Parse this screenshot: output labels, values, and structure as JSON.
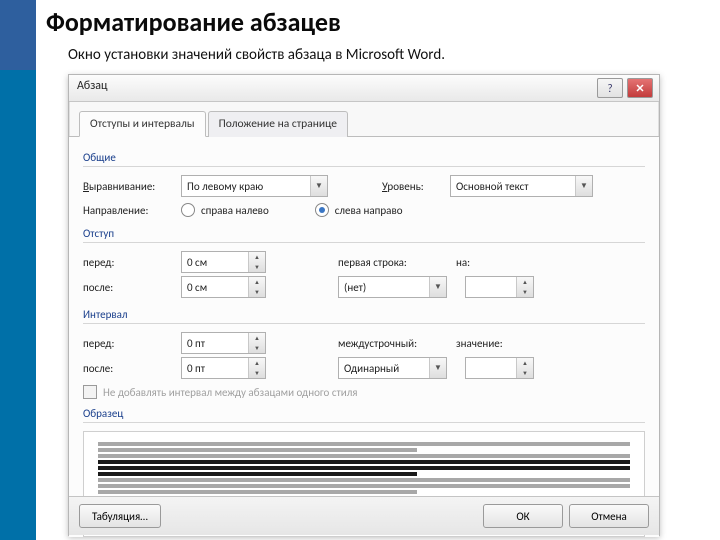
{
  "heading": "Форматирование абзацев",
  "subhead": "Окно установки значений свойств абзаца в Microsoft Word.",
  "dialog": {
    "title": "Абзац",
    "help": "?",
    "close": "✕",
    "tabs": [
      "Отступы и интервалы",
      "Положение на странице"
    ],
    "groups": {
      "general": {
        "label": "Общие",
        "align_label": "Выравнивание:",
        "align_value": "По левому краю",
        "level_label": "Уровень:",
        "level_value": "Основной текст",
        "dir_label": "Направление:",
        "rtl": "справа налево",
        "ltr": "слева направо"
      },
      "indent": {
        "label": "Отступ",
        "before_label": "перед:",
        "before_value": "0 см",
        "after_label": "после:",
        "after_value": "0 см",
        "first_label": "первая строка:",
        "by_label": "на:",
        "first_value": "(нет)"
      },
      "spacing": {
        "label": "Интервал",
        "before_label": "перед:",
        "before_value": "0 пт",
        "after_label": "после:",
        "after_value": "0 пт",
        "line_label": "междустрочный:",
        "value_label": "значение:",
        "line_value": "Одинарный",
        "nospace": "Не добавлять интервал между абзацами одного стиля"
      },
      "preview": {
        "label": "Образец"
      }
    },
    "footer": {
      "tabs_btn": "Табуляция…",
      "ok": "ОК",
      "cancel": "Отмена"
    }
  }
}
